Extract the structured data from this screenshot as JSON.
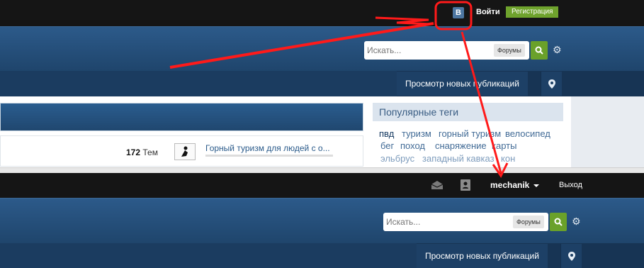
{
  "guest_view": {
    "top_bar": {
      "vk_icon_letter": "B",
      "login_label": "Войти",
      "register_label": "Регистрация"
    },
    "search": {
      "placeholder": "Искать...",
      "scope_label": "Форумы"
    },
    "subnav": {
      "new_posts_label": "Просмотр новых публикаций"
    },
    "forum_row": {
      "topic_count": "172",
      "topic_unit": "Тем",
      "latest_title": "Горный туризм для людей с о..."
    },
    "popular_tags": {
      "header": "Популярные теги",
      "tags_row1": [
        "пвд",
        "туризм",
        "горный туризм",
        "велосипед"
      ],
      "tags_row2": [
        "бег",
        "поход",
        "снаряжение",
        "карты"
      ],
      "tags_row3": [
        "эльбрус",
        "западный кавказ",
        "кон"
      ]
    }
  },
  "user_view": {
    "top_bar": {
      "username": "mechanik",
      "logout_label": "Выход"
    },
    "search": {
      "placeholder": "Искать...",
      "scope_label": "Форумы"
    },
    "subnav": {
      "new_posts_label": "Просмотр новых публикаций"
    }
  },
  "colors": {
    "topbar": "#151515",
    "header": "#2c5a8a",
    "accent_green": "#6fa32d",
    "annotation_red": "#ff1a1a"
  },
  "icons": [
    "vk-icon",
    "search-icon",
    "gear-icon",
    "map-pin-icon",
    "envelope-icon",
    "contact-card-icon",
    "chevron-down-icon"
  ]
}
